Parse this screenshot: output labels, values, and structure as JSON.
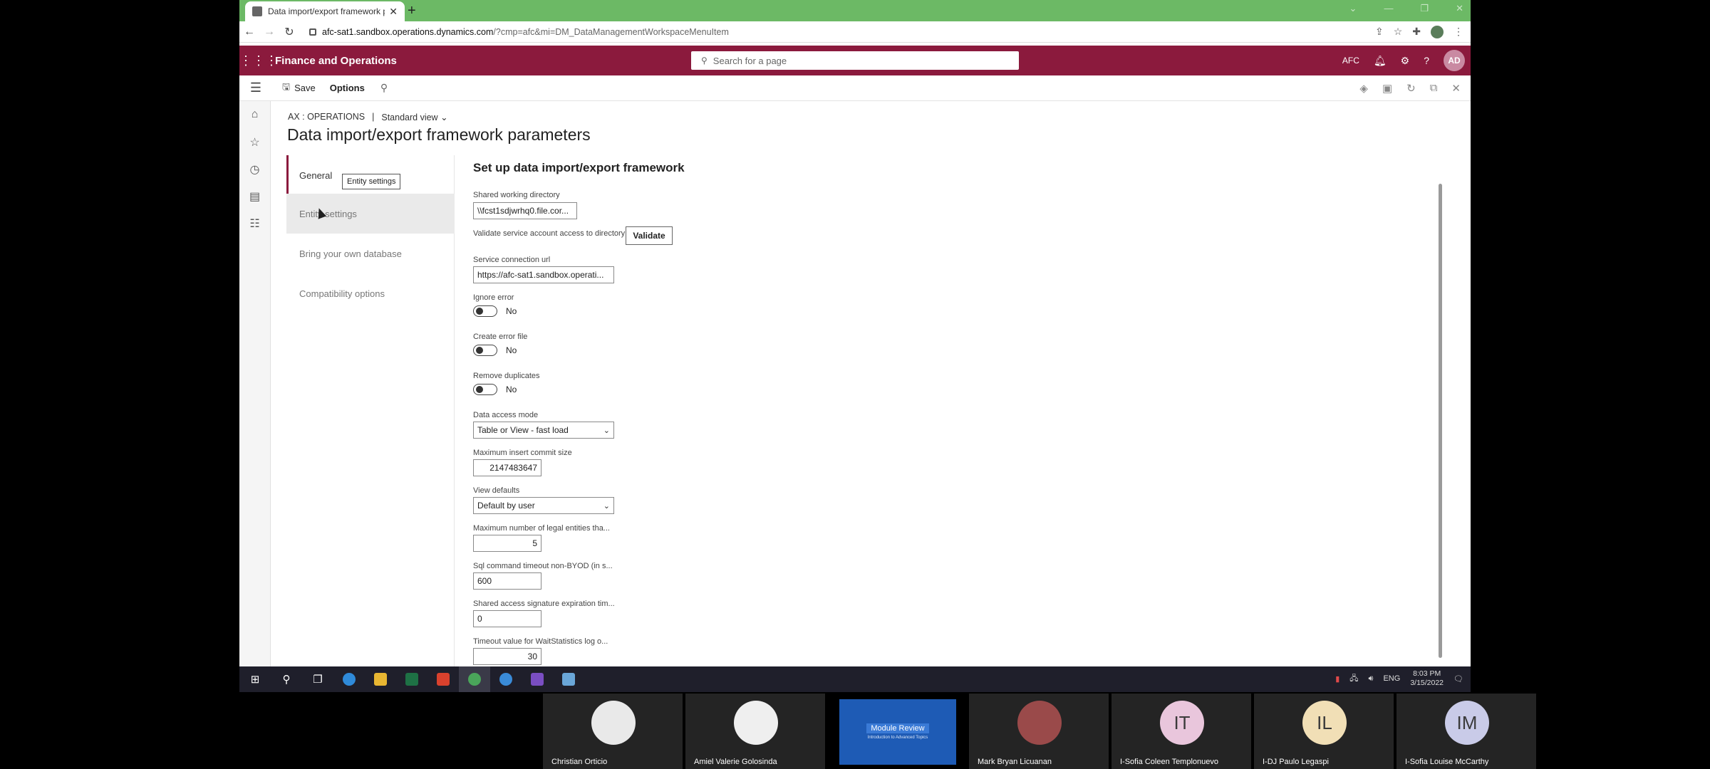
{
  "browser": {
    "tab_title": "Data import/export framework p",
    "new_tab": "+",
    "url_domain": "afc-sat1.sandbox.operations.dynamics.com",
    "url_path": "/?cmp=afc&mi=DM_DataManagementWorkspaceMenuItem"
  },
  "d365": {
    "app_name": "Finance and Operations",
    "search_placeholder": "Search for a page",
    "company": "AFC",
    "avatar_initials": "AD",
    "accent_color": "#8b1a3d"
  },
  "actionbar": {
    "save_label": "Save",
    "options_label": "Options"
  },
  "page": {
    "company_crumb": "AX : OPERATIONS",
    "separator": "|",
    "view_label": "Standard view",
    "title": "Data import/export framework parameters"
  },
  "sections": [
    {
      "label": "General"
    },
    {
      "label": "Entity settings"
    },
    {
      "label": "Bring your own database"
    },
    {
      "label": "Compatibility options"
    }
  ],
  "tooltip": "Entity settings",
  "form": {
    "title": "Set up data import/export framework",
    "shared_dir_label": "Shared working directory",
    "shared_dir_value": "\\\\fcst1sdjwrhq0.file.cor...",
    "validate_label": "Validate service account access to directory",
    "validate_button": "Validate",
    "service_url_label": "Service connection url",
    "service_url_value": "https://afc-sat1.sandbox.operati...",
    "ignore_error_label": "Ignore error",
    "ignore_error_value": "No",
    "create_error_label": "Create error file",
    "create_error_value": "No",
    "remove_dup_label": "Remove duplicates",
    "remove_dup_value": "No",
    "access_mode_label": "Data access mode",
    "access_mode_value": "Table or View - fast load",
    "max_commit_label": "Maximum insert commit size",
    "max_commit_value": "2147483647",
    "view_defaults_label": "View defaults",
    "view_defaults_value": "Default by user",
    "max_legal_label": "Maximum number of legal entities tha...",
    "max_legal_value": "5",
    "sql_timeout_label": "Sql command timeout non-BYOD (in s...",
    "sql_timeout_value": "600",
    "sas_label": "Shared access signature expiration tim...",
    "sas_value": "0",
    "wait_label": "Timeout value for WaitStatistics log o...",
    "wait_value": "30"
  },
  "taskbar": {
    "lang": "ENG",
    "time": "8:03 PM",
    "date": "3/15/2022"
  },
  "meeting": {
    "shared_title": "Module Review",
    "shared_sub": "Introduction to Advanced Topics",
    "participants": [
      {
        "name": "Christian Orticio",
        "initials": ""
      },
      {
        "name": "Amiel Valerie Golosinda",
        "initials": ""
      },
      {
        "name": "Mark Bryan Licuanan",
        "initials": ""
      },
      {
        "name": "I-Sofia Coleen Templonuevo",
        "initials": "IT"
      },
      {
        "name": "I-DJ Paulo Legaspi",
        "initials": "IL"
      },
      {
        "name": "I-Sofia Louise McCarthy",
        "initials": "IM"
      }
    ]
  }
}
